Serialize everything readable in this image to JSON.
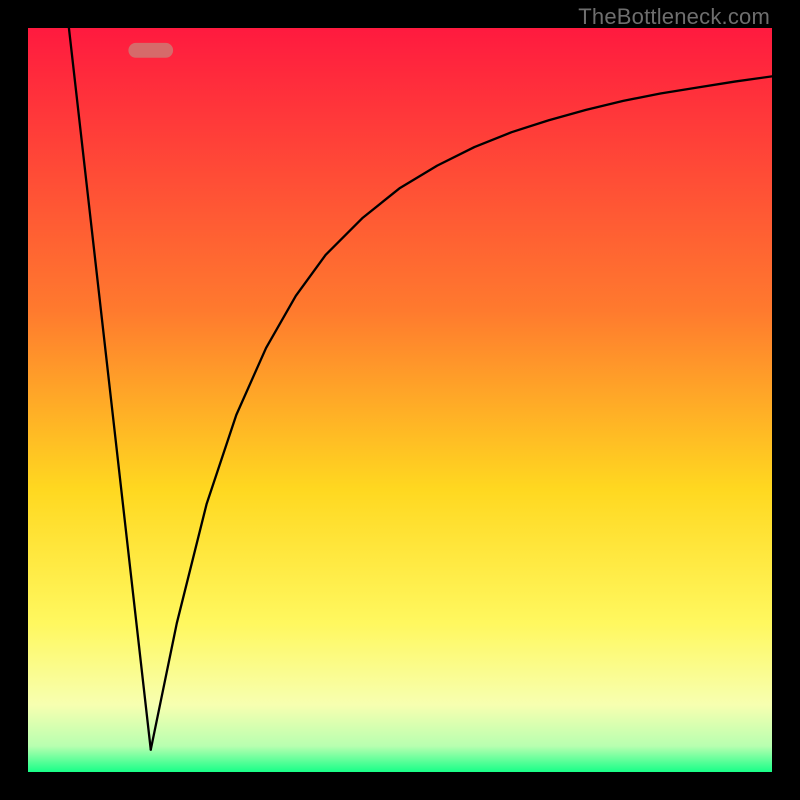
{
  "watermark": "TheBottleneck.com",
  "chart_data": {
    "type": "line",
    "title": "",
    "xlabel": "",
    "ylabel": "",
    "xlim": [
      0,
      100
    ],
    "ylim": [
      0,
      100
    ],
    "grid": false,
    "legend": false,
    "background_gradient": {
      "direction": "vertical",
      "stops": [
        {
          "pos": 0.0,
          "color": "#ff1a3f"
        },
        {
          "pos": 0.38,
          "color": "#ff7a2e"
        },
        {
          "pos": 0.62,
          "color": "#ffd820"
        },
        {
          "pos": 0.8,
          "color": "#fff85f"
        },
        {
          "pos": 0.91,
          "color": "#f7ffb0"
        },
        {
          "pos": 0.965,
          "color": "#b8ffb0"
        },
        {
          "pos": 1.0,
          "color": "#18ff88"
        }
      ]
    },
    "marker": {
      "x": 16.5,
      "y": 97,
      "width": 6,
      "height": 2,
      "color": "#d66a6a",
      "shape": "rounded-rect"
    },
    "series": [
      {
        "name": "left-line",
        "type": "line",
        "stroke": "#000000",
        "stroke_width": 2.3,
        "x": [
          5.5,
          16.5
        ],
        "y": [
          100,
          3
        ]
      },
      {
        "name": "right-curve",
        "type": "line",
        "stroke": "#000000",
        "stroke_width": 2.3,
        "x": [
          16.5,
          20,
          24,
          28,
          32,
          36,
          40,
          45,
          50,
          55,
          60,
          65,
          70,
          75,
          80,
          85,
          90,
          95,
          100
        ],
        "y": [
          3,
          20,
          36,
          48,
          57,
          64,
          69.5,
          74.5,
          78.5,
          81.5,
          84,
          86,
          87.6,
          89,
          90.2,
          91.2,
          92,
          92.8,
          93.5
        ]
      }
    ]
  }
}
